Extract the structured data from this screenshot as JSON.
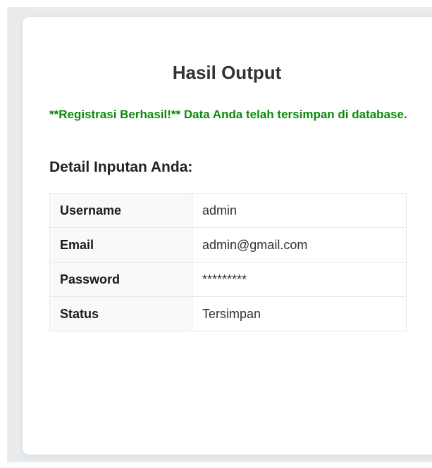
{
  "page": {
    "title": "Hasil Output",
    "success_message": "**Registrasi Berhasil!** Data Anda telah tersimpan di database.",
    "detail_heading": "Detail Inputan Anda:"
  },
  "details": [
    {
      "label": "Username",
      "value": "admin"
    },
    {
      "label": "Email",
      "value": "admin@gmail.com"
    },
    {
      "label": "Password",
      "value": "*********"
    },
    {
      "label": "Status",
      "value": "Tersimpan"
    }
  ],
  "colors": {
    "success": "#0a8a0a",
    "background": "#e9ecef",
    "card": "#ffffff",
    "label_cell": "#f8f9fa"
  }
}
